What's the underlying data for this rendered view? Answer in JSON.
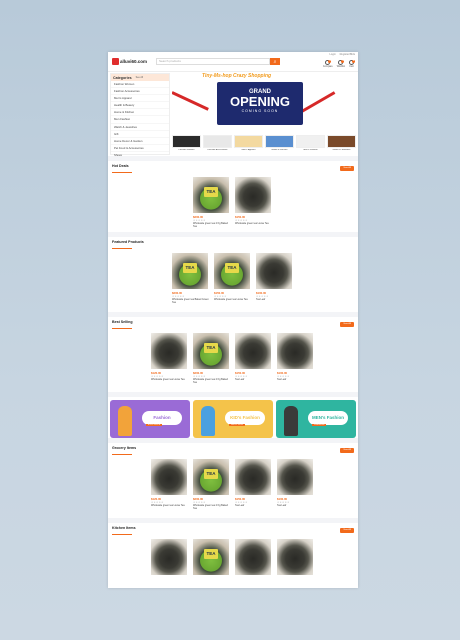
{
  "header": {
    "logo": "alluvi60.com",
    "search_placeholder": "Search products",
    "search_icon": "search-icon",
    "links": [
      "Login",
      "Register/Bids"
    ],
    "icons": [
      {
        "name": "compare-icon",
        "label": "Compare",
        "count": "0"
      },
      {
        "name": "wishlist-icon",
        "label": "Wishlist",
        "count": "0"
      },
      {
        "name": "cart-icon",
        "label": "Cart",
        "count": "0"
      }
    ]
  },
  "categories": {
    "title": "Categories",
    "see_all": "See All",
    "items": [
      "Fashion Women",
      "Fashion Accessories",
      "Men's Apparel",
      "Health & Beauty",
      "Home & Kitchen",
      "Men Fashion",
      "Watch & Jewelries",
      "Gift",
      "Home Decor & Garden",
      "Pet Food & Accessories",
      "Shoes"
    ]
  },
  "banner": {
    "top_text": "Tiny-Ms-hop Crazy Shopping",
    "line1": "GRAND",
    "line2": "OPENING",
    "line3": "COMING SOON",
    "thumbs": [
      "Fashion Women",
      "Fashion Accessories",
      "Men's Apparel",
      "Home & Kitchen",
      "Men's Fashion",
      "Watch & Jewelries"
    ]
  },
  "sections": [
    {
      "title": "Hot Deals",
      "view_all": "View All",
      "products": [
        {
          "img": "green",
          "price": "$200.00",
          "name": "Wholesale green tea 2 Kg Baked Tea"
        },
        {
          "img": "dark",
          "price": "$150.00",
          "name": "Wholesale green tea Loose Tea"
        }
      ]
    },
    {
      "title": "Featured Products",
      "view_all": "",
      "products": [
        {
          "img": "green",
          "price": "$200.00",
          "name": "Wholesale green tea Baked Green Tea"
        },
        {
          "img": "green",
          "price": "$150.00",
          "name": "Wholesale green tea Loose Tea"
        },
        {
          "img": "dark",
          "price": "$100.00",
          "name": "Tea Leaf"
        }
      ]
    },
    {
      "title": "Best Selling",
      "view_all": "View All",
      "products": [
        {
          "img": "dark",
          "price": "$120.00",
          "name": "Wholesale green tea Loose Tea"
        },
        {
          "img": "green",
          "price": "$200.00",
          "name": "Wholesale green tea 2 Kg Baked Tea"
        },
        {
          "img": "dark",
          "price": "$150.00",
          "name": "Tea Leaf"
        },
        {
          "img": "dark",
          "price": "$100.00",
          "name": "Tea Leaf"
        }
      ]
    },
    {
      "title": "Grocery Items",
      "view_all": "View All",
      "products": [
        {
          "img": "dark",
          "price": "$120.00",
          "name": "Wholesale green tea Loose Tea"
        },
        {
          "img": "green",
          "price": "$200.00",
          "name": "Wholesale green tea 2 Kg Baked Tea"
        },
        {
          "img": "dark",
          "price": "$150.00",
          "name": "Tea Leaf"
        },
        {
          "img": "dark",
          "price": "$100.00",
          "name": "Tea Leaf"
        }
      ]
    },
    {
      "title": "Kitchen Items",
      "view_all": "View All",
      "products": [
        {
          "img": "dark",
          "price": "",
          "name": ""
        },
        {
          "img": "green",
          "price": "",
          "name": ""
        },
        {
          "img": "dark",
          "price": "",
          "name": ""
        },
        {
          "img": "dark",
          "price": "",
          "name": ""
        }
      ]
    }
  ],
  "promos": [
    {
      "title": "Fashion",
      "sub": "EXCLUSIVE",
      "bg": "#9a6bd6",
      "tag": "#ffffff",
      "fig": "#f2a33a"
    },
    {
      "title": "KID's Fashion",
      "sub": "SHOP NOW",
      "bg": "#f4c34a",
      "tag": "#ffffff",
      "fig": "#4aa0e0"
    },
    {
      "title": "MEN's Fashion",
      "sub": "PREMIUM",
      "bg": "#2fb5a0",
      "tag": "#ffffff",
      "fig": "#3a3a3a"
    }
  ],
  "stars": "★★★★★",
  "colors": {
    "accent": "#f26a1b",
    "banner": "#1e2a6e"
  }
}
